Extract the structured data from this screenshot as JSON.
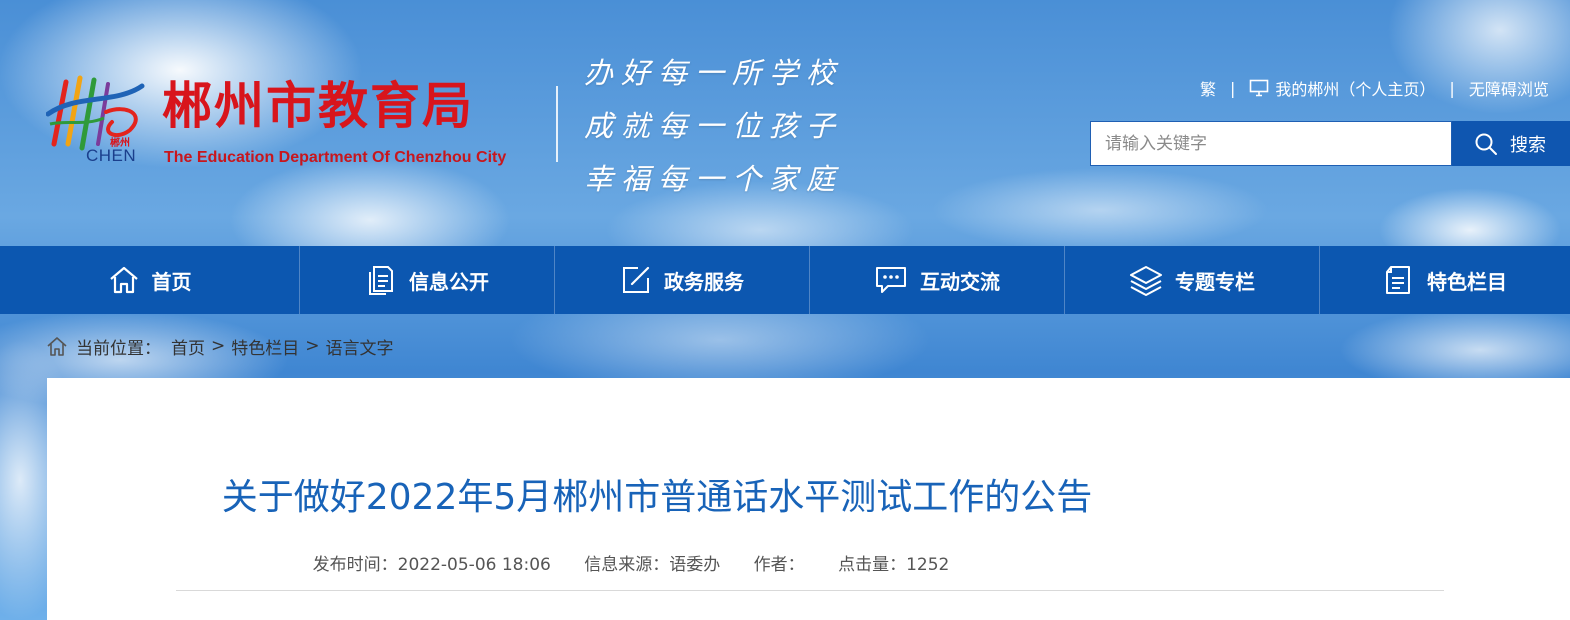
{
  "header": {
    "logo_title": "郴州市教育局",
    "logo_subtitle": "The Education Department Of Chenzhou City",
    "logo_small": "郴州",
    "logo_chen": "CHEN",
    "slogans": [
      "办好每一所学校",
      "成就每一位孩子",
      "幸福每一个家庭"
    ],
    "brand_color": "#d8151c"
  },
  "toplinks": {
    "traditional": "繁",
    "my_chenzhou": "我的郴州（个人主页）",
    "accessibility": "无障碍浏览"
  },
  "search": {
    "placeholder": "请输入关键字",
    "button_label": "搜索"
  },
  "nav": {
    "items": [
      {
        "label": "首页",
        "icon": "home-icon"
      },
      {
        "label": "信息公开",
        "icon": "document-icon"
      },
      {
        "label": "政务服务",
        "icon": "edit-icon"
      },
      {
        "label": "互动交流",
        "icon": "chat-icon"
      },
      {
        "label": "专题专栏",
        "icon": "layers-icon"
      },
      {
        "label": "特色栏目",
        "icon": "list-icon"
      }
    ],
    "color": "#0c57b0"
  },
  "breadcrumb": {
    "prefix": "当前位置：",
    "items": [
      "首页",
      "特色栏目",
      "语言文字"
    ]
  },
  "article": {
    "title": "关于做好2022年5月郴州市普通话水平测试工作的公告",
    "publish_time": "发布时间：2022-05-06 18:06",
    "source": "信息来源：语委办",
    "author": "作者：",
    "hits": "点击量：1252",
    "title_color": "#1863b8"
  }
}
